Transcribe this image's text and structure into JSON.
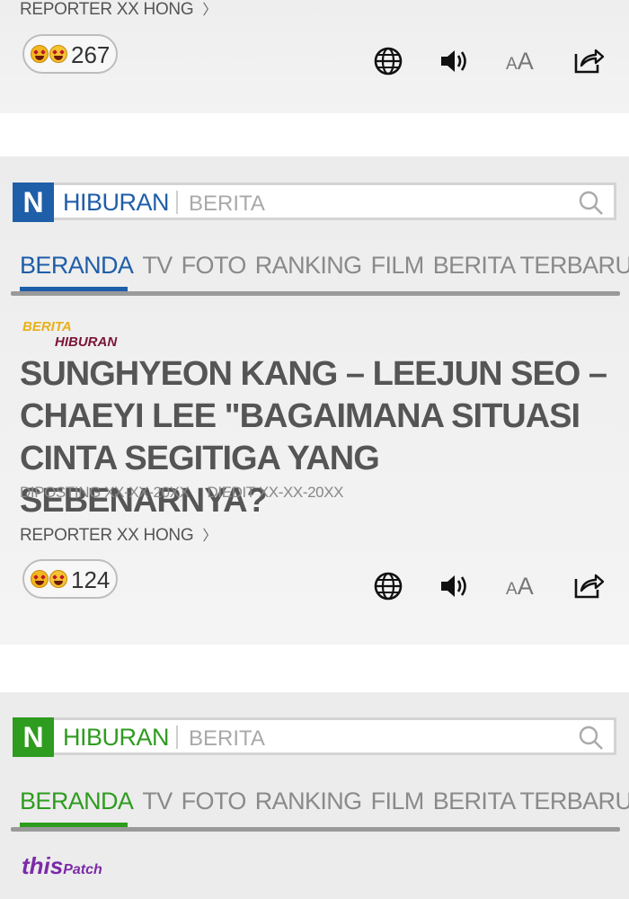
{
  "colors": {
    "blue_accent": "#1f5ea8",
    "green_accent": "#2e9c1f",
    "gray_text": "#555555"
  },
  "top_card": {
    "reporter": "REPORTER XX HONG",
    "chevron": "〉",
    "reaction_count": "267"
  },
  "section_blue": {
    "logo": "N",
    "category": "HIBURAN",
    "subcategory": "BERITA",
    "nav": [
      "BERANDA",
      "TV",
      "FOTO",
      "RANKING",
      "FILM",
      "BERITA TERBARU"
    ],
    "badge_line1": "BERITA",
    "badge_line2": "HIBURAN",
    "headline_line1": "SUNGHYEON KANG – LEEJUN SEO –",
    "headline_line2": "CHAEYI LEE \"BAGAIMANA SITUASI",
    "headline_line3": "CINTA SEGITIGA YANG SEBENARNYA?",
    "posted": "DIPOSTING XX-XX-20XX",
    "edited": "DIEDIT XX-XX-20XX",
    "reporter": "REPORTER XX HONG",
    "chevron": "〉",
    "reaction_count": "124"
  },
  "section_green": {
    "logo": "N",
    "category": "HIBURAN",
    "subcategory": "BERITA",
    "nav": [
      "BERANDA",
      "TV",
      "FOTO",
      "RANKING",
      "FILM",
      "BERITA TERBARU"
    ],
    "badge_this": "this",
    "badge_patch": "Patch"
  },
  "tools": {
    "font_small": "A",
    "font_big": "A"
  },
  "icons": [
    "globe-icon",
    "speaker-icon",
    "font-size-icon",
    "share-icon",
    "search-icon",
    "emoji-icon"
  ]
}
